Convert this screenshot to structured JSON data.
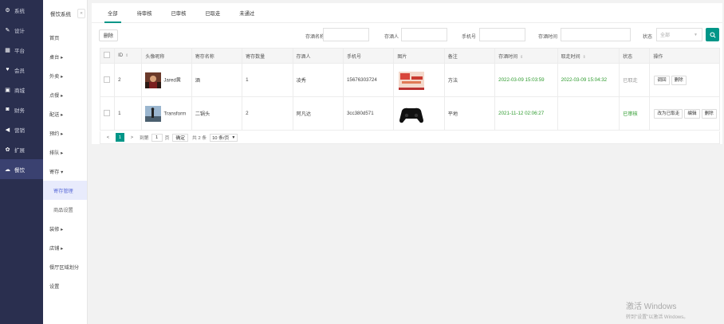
{
  "sidebar": {
    "items": [
      {
        "label": "系统",
        "icon": "gear-icon"
      },
      {
        "label": "设计",
        "icon": "brush-icon"
      },
      {
        "label": "平台",
        "icon": "grid-icon"
      },
      {
        "label": "会员",
        "icon": "heart-icon"
      },
      {
        "label": "商城",
        "icon": "shop-icon"
      },
      {
        "label": "财务",
        "icon": "wallet-icon"
      },
      {
        "label": "营销",
        "icon": "megaphone-icon"
      },
      {
        "label": "扩展",
        "icon": "puzzle-icon"
      },
      {
        "label": "餐饮",
        "icon": "cloud-icon",
        "active": true
      }
    ]
  },
  "subnav": {
    "title": "餐饮系统",
    "collapse_glyph": "«",
    "items": [
      {
        "label": "首页",
        "level": 0
      },
      {
        "label": "桌台 ▸",
        "level": 0
      },
      {
        "label": "外卖 ▸",
        "level": 0
      },
      {
        "label": "点餐 ▸",
        "level": 0
      },
      {
        "label": "配送 ▸",
        "level": 0
      },
      {
        "label": "预约 ▸",
        "level": 0
      },
      {
        "label": "排队 ▸",
        "level": 0
      },
      {
        "label": "寄存 ▾",
        "level": 0
      },
      {
        "label": "寄存管理",
        "level": 1,
        "selected": true
      },
      {
        "label": "商品设置",
        "level": 1
      },
      {
        "label": "装修 ▸",
        "level": 0
      },
      {
        "label": "店铺 ▸",
        "level": 0
      },
      {
        "label": "餐厅区域划分",
        "level": 0
      },
      {
        "label": "设置",
        "level": 0
      }
    ]
  },
  "tabs": [
    "全部",
    "待审核",
    "已审核",
    "已取走",
    "未通过"
  ],
  "toolbar": {
    "delete_label": "删除",
    "filters": [
      {
        "label": "存酒名称",
        "value": ""
      },
      {
        "label": "存酒人",
        "value": ""
      },
      {
        "label": "手机号",
        "value": ""
      },
      {
        "label": "存酒时间",
        "value": ""
      }
    ],
    "status_label": "状态",
    "status_selected": "全部"
  },
  "table": {
    "columns": [
      "",
      "ID",
      "头像昵称",
      "寄存名称",
      "寄存数量",
      "存酒人",
      "手机号",
      "图片",
      "备注",
      "存酒时间",
      "取走时间",
      "状态",
      "操作"
    ],
    "rows": [
      {
        "id": "2",
        "nickname": "Jared黄",
        "name": "酒",
        "qty": "1",
        "person": "凌秀",
        "phone": "15676303724",
        "remark": "方法",
        "store_time": "2022-03-09 15:03:59",
        "take_time": "2022-03-09 15:04:32",
        "status": "已取走",
        "actions": [
          "调回",
          "删除"
        ]
      },
      {
        "id": "1",
        "nickname": "Transform",
        "name": "二锅头",
        "qty": "2",
        "person": "阿凡达",
        "phone": "3cc380d571",
        "remark": "平地",
        "store_time": "2021-11-12 02:06:27",
        "take_time": "",
        "status": "已审核",
        "actions": [
          "改为已取走",
          "编辑",
          "删除"
        ]
      }
    ]
  },
  "pager": {
    "prev": "<",
    "current": "1",
    "next": ">",
    "goto_label": "到第",
    "page_value": "1",
    "page_unit": "页",
    "confirm": "确定",
    "total": "共 2 条",
    "per_page": "10 条/页"
  },
  "watermark": {
    "line1": "激活 Windows",
    "line2": "转到\"设置\"以激活 Windows。"
  },
  "colors": {
    "accent": "#009688",
    "sidebar": "#2a2f4f",
    "green_time": "#2e9b2e"
  }
}
